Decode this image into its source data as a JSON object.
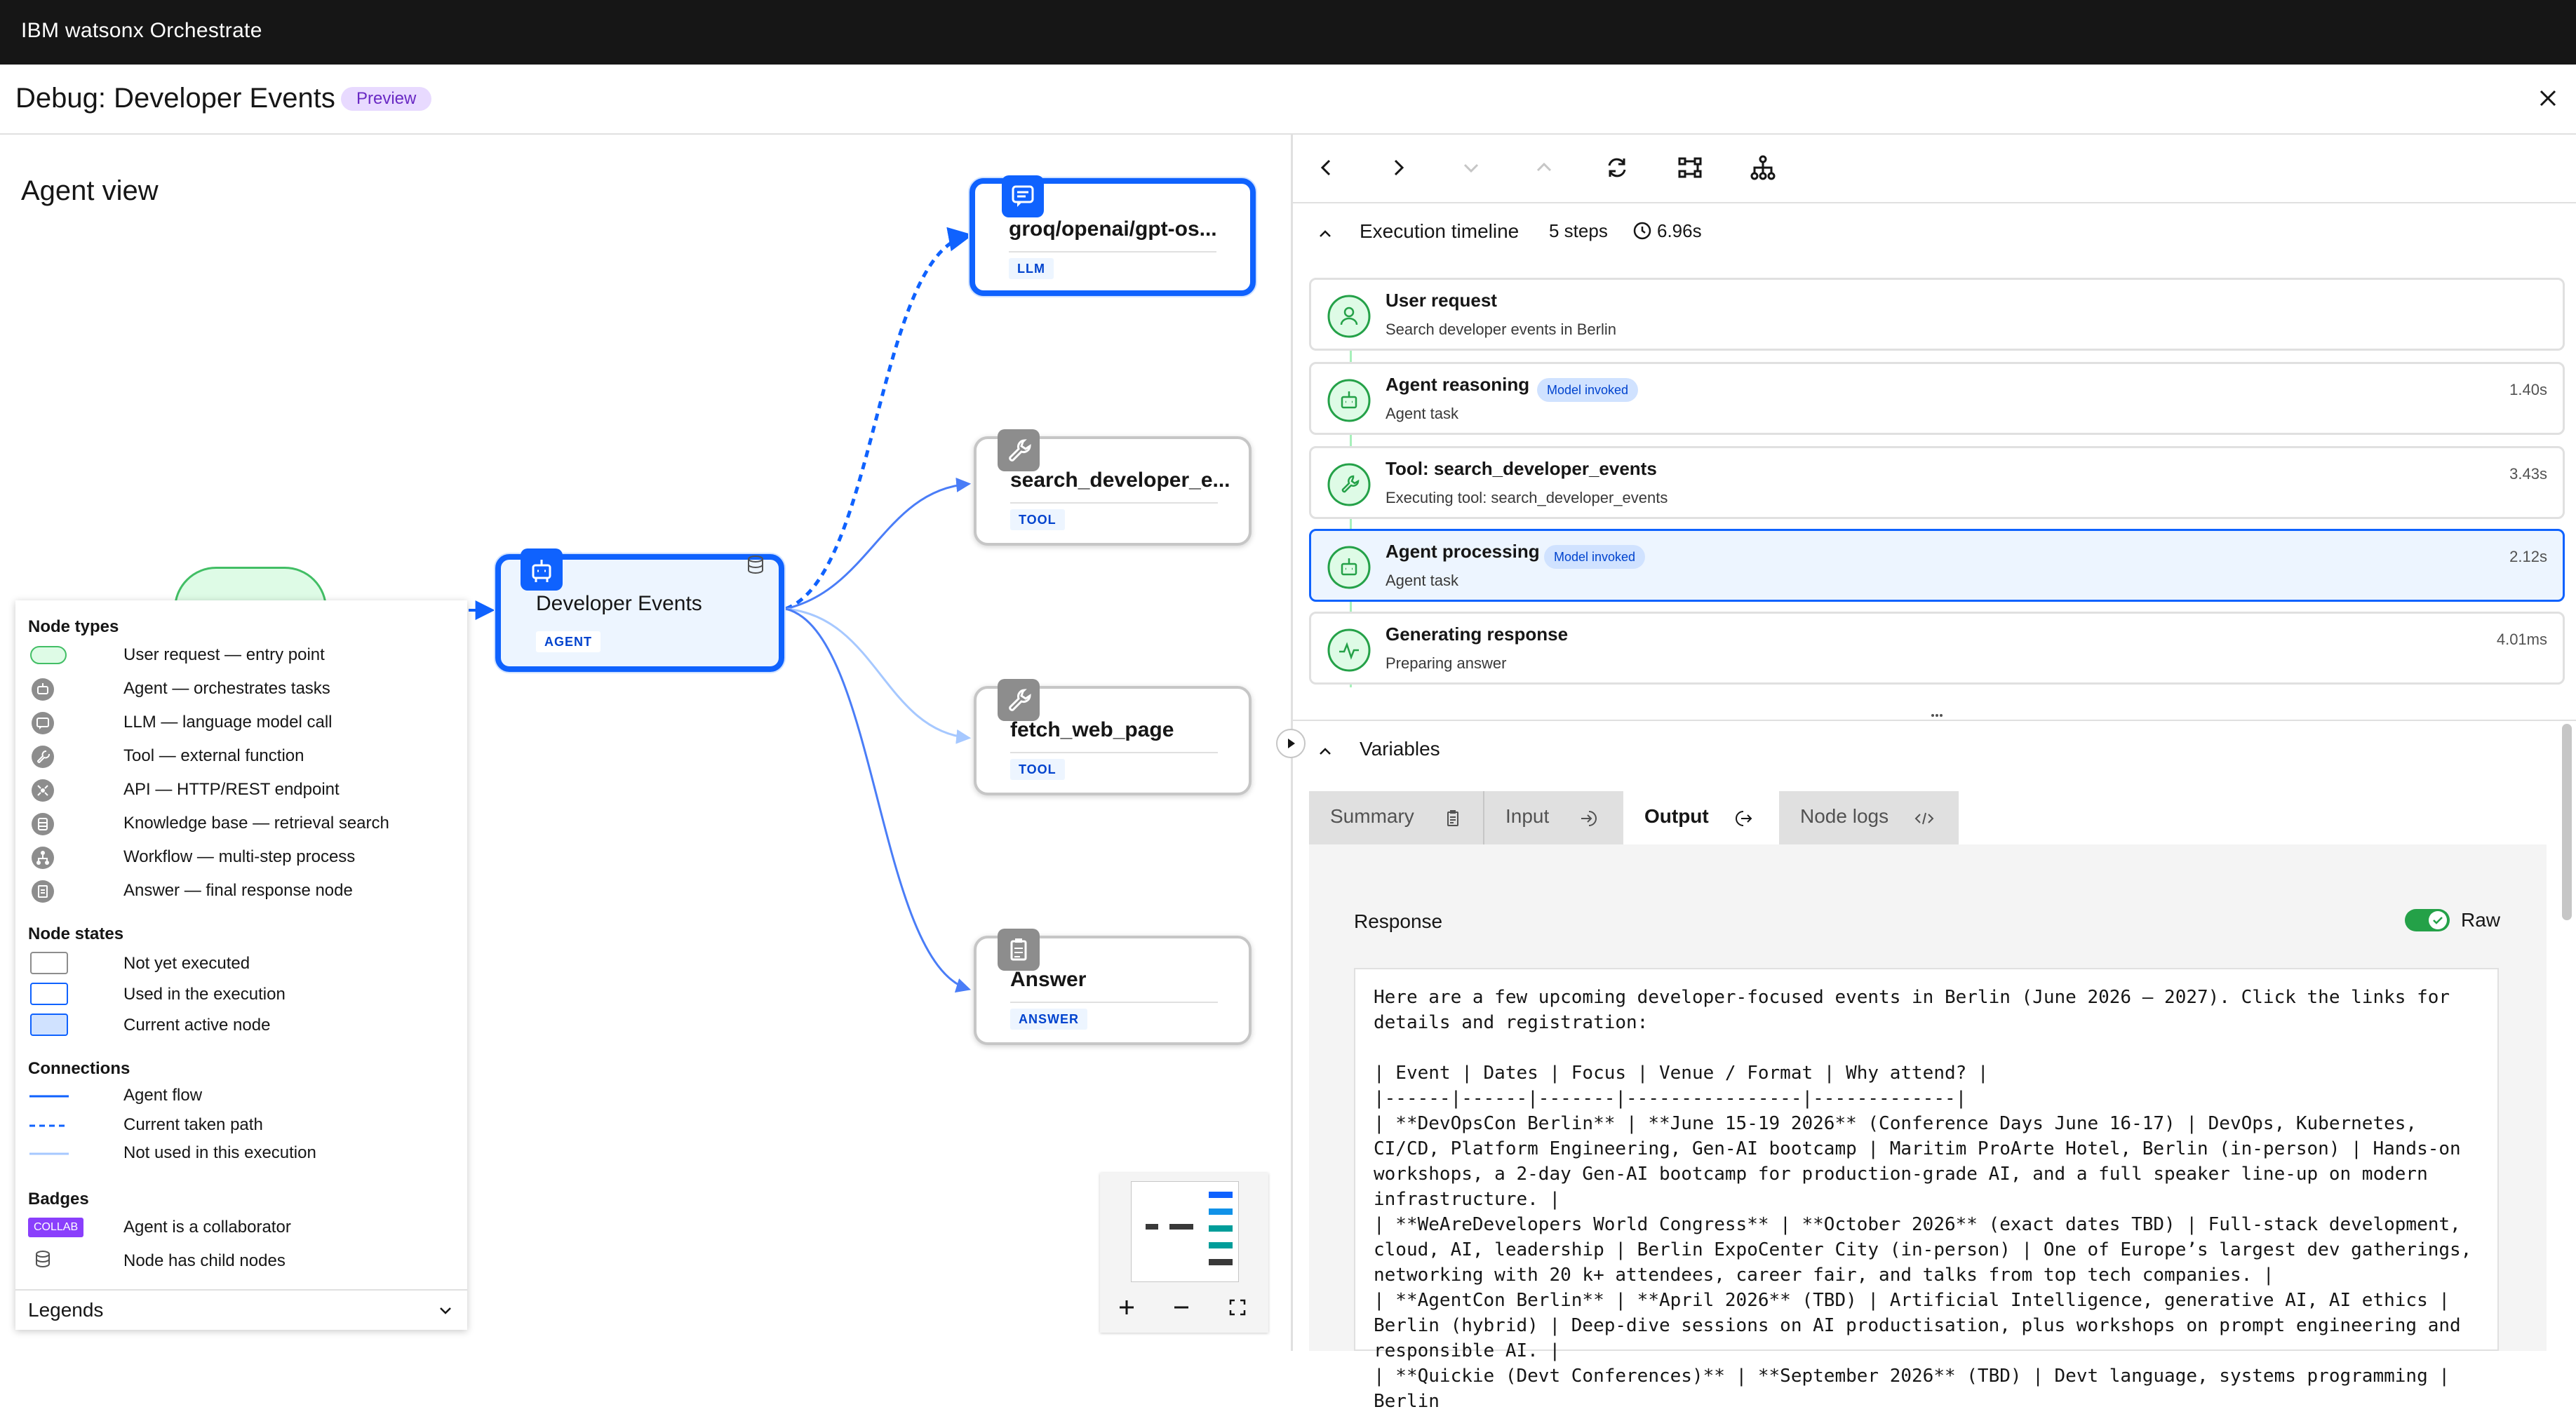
{
  "app": {
    "title": "IBM watsonx Orchestrate"
  },
  "header": {
    "title": "Debug: Developer Events",
    "badge": "Preview"
  },
  "agent_view": {
    "title": "Agent view",
    "nodes": [
      {
        "name": "groq/openai/gpt-os...",
        "tag": "LLM",
        "icon": "chat-icon"
      },
      {
        "name": "search_developer_e...",
        "tag": "TOOL",
        "icon": "wrench-icon"
      },
      {
        "name": "Developer Events",
        "tag": "AGENT",
        "icon": "agent-icon"
      },
      {
        "name": "fetch_web_page",
        "tag": "TOOL",
        "icon": "wrench-icon"
      },
      {
        "name": "Answer",
        "tag": "ANSWER",
        "icon": "clipboard-icon"
      }
    ]
  },
  "legend": {
    "node_types_title": "Node types",
    "node_types": [
      {
        "label": "User request — entry point",
        "icon": "pill-icon"
      },
      {
        "label": "Agent — orchestrates tasks",
        "icon": "agent-icon"
      },
      {
        "label": "LLM — language model call",
        "icon": "chat-icon"
      },
      {
        "label": "Tool — external function",
        "icon": "wrench-icon"
      },
      {
        "label": "API — HTTP/REST endpoint",
        "icon": "api-icon"
      },
      {
        "label": "Knowledge base — retrieval search",
        "icon": "database-icon"
      },
      {
        "label": "Workflow — multi-step process",
        "icon": "workflow-icon"
      },
      {
        "label": "Answer — final response node",
        "icon": "clipboard-icon"
      }
    ],
    "node_states_title": "Node states",
    "node_states": [
      {
        "label": "Not yet executed"
      },
      {
        "label": "Used in the execution"
      },
      {
        "label": "Current active node"
      }
    ],
    "connections_title": "Connections",
    "connections": [
      {
        "label": "Agent flow"
      },
      {
        "label": "Current taken path"
      },
      {
        "label": "Not used in this execution"
      }
    ],
    "badges_title": "Badges",
    "badges": [
      {
        "label": "Agent is a collaborator",
        "chip": "COLLAB"
      },
      {
        "label": "Node has child nodes"
      }
    ],
    "footer_label": "Legends"
  },
  "timeline": {
    "title": "Execution timeline",
    "steps_count": "5 steps",
    "duration": "6.96s",
    "steps": [
      {
        "title": "User request",
        "subtitle": "Search developer events in Berlin",
        "time": "",
        "badge": ""
      },
      {
        "title": "Agent reasoning",
        "subtitle": "Agent task",
        "time": "1.40s",
        "badge": "Model invoked"
      },
      {
        "title": "Tool: search_developer_events",
        "subtitle": "Executing tool: search_developer_events",
        "time": "3.43s",
        "badge": ""
      },
      {
        "title": "Agent processing",
        "subtitle": "Agent task",
        "time": "2.12s",
        "badge": "Model invoked"
      },
      {
        "title": "Generating response",
        "subtitle": "Preparing answer",
        "time": "4.01ms",
        "badge": ""
      }
    ]
  },
  "variables": {
    "title": "Variables",
    "tabs": [
      {
        "label": "Summary"
      },
      {
        "label": "Input"
      },
      {
        "label": "Output"
      },
      {
        "label": "Node logs"
      }
    ],
    "active_tab": "Output",
    "response_label": "Response",
    "raw_label": "Raw",
    "raw_enabled": true,
    "response_text": "Here are a few upcoming developer-focused events in Berlin (June 2026 – 2027). Click the links for details and registration:\n\n| Event | Dates | Focus | Venue / Format | Why attend? |\n|------|------|-------|----------------|-------------|\n| **DevOpsCon Berlin** | **June 15-19 2026** (Conference Days June 16-17) | DevOps, Kubernetes, CI/CD, Platform Engineering, Gen-AI bootcamp | Maritim ProArte Hotel, Berlin (in-person) | Hands-on workshops, a 2-day Gen-AI bootcamp for production-grade AI, and a full speaker line-up on modern infrastructure. |\n| **WeAreDevelopers World Congress** | **October 2026** (exact dates TBD) | Full-stack development, cloud, AI, leadership | Berlin ExpoCenter City (in-person) | One of Europe’s largest dev gatherings, networking with 20 k+ attendees, career fair, and talks from top tech companies. |\n| **AgentCon Berlin** | **April 2026** (TBD) | Artificial Intelligence, generative AI, AI ethics | Berlin (hybrid) | Deep-dive sessions on AI productisation, plus workshops on prompt engineering and responsible AI. |\n| **Quickie (Devt Conferences)** | **September 2026** (TBD) | Devt language, systems programming | Berlin"
  },
  "colors": {
    "accent": "#0f62fe",
    "topbar": "#161616",
    "success": "#24a148",
    "preview_bg": "#e8daff",
    "preview_fg": "#6929c4"
  }
}
